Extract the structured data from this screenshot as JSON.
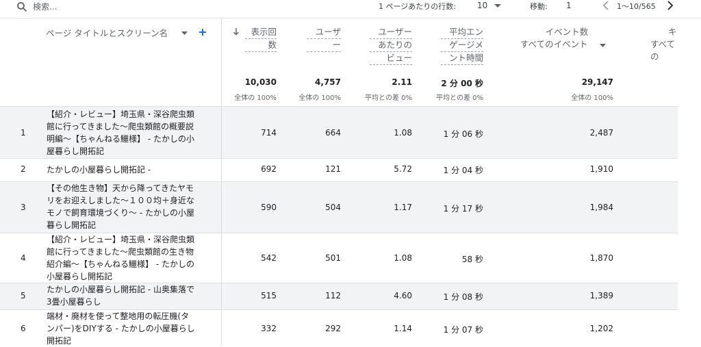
{
  "search": {
    "placeholder": "検索..."
  },
  "pagination": {
    "rows_label": "1 ページあたりの行数:",
    "rows_value": "10",
    "goto_label": "移動:",
    "goto_value": "1",
    "range": "1〜10/565"
  },
  "headers": {
    "dimension": "ページ タイトルとスクリーン名",
    "views": [
      "表示回",
      "数"
    ],
    "users": [
      "ユーザ",
      "ー"
    ],
    "views_per_user": [
      "ユーザー",
      "あたりの",
      "ビュー"
    ],
    "avg_engagement": [
      "平均エン",
      "ゲージメ",
      "ント時間"
    ],
    "event_count": "イベント数",
    "event_filter": "すべてのイベント",
    "next_col": "キ",
    "next_col_sub": "すべての"
  },
  "totals": {
    "views": "10,030",
    "views_sub": "全体の 100%",
    "users": "4,757",
    "users_sub": "全体の 100%",
    "vpu": "2.11",
    "vpu_sub": "平均との差 0%",
    "eng": "2 分 00 秒",
    "eng_sub": "平均との差 0%",
    "events": "29,147",
    "events_sub": "全体の 100%"
  },
  "rows": [
    {
      "n": "1",
      "title": [
        "【紹介・レビュー】埼玉県・深谷爬虫類",
        "館に行ってきました〜爬虫類館の概要説",
        "明編〜【ちゃんねる鱷様】 - たかしの小",
        "屋暮らし開拓記"
      ],
      "views": "714",
      "users": "664",
      "vpu": "1.08",
      "eng": "1 分 06 秒",
      "events": "2,487"
    },
    {
      "n": "2",
      "title": [
        "たかしの小屋暮らし開拓記 -"
      ],
      "views": "692",
      "users": "121",
      "vpu": "5.72",
      "eng": "1 分 04 秒",
      "events": "1,910"
    },
    {
      "n": "3",
      "title": [
        "【その他生き物】天から降ってきたヤモ",
        "リをお迎えしました〜１００均＋身近な",
        "モノで飼育環境づくり〜 - たかしの小屋",
        "暮らし開拓記"
      ],
      "views": "590",
      "users": "504",
      "vpu": "1.17",
      "eng": "1 分 17 秒",
      "events": "1,984"
    },
    {
      "n": "4",
      "title": [
        "【紹介・レビュー】埼玉県・深谷爬虫類",
        "館に行ってきました〜爬虫類館の生き物",
        "紹介編〜【ちゃんねる鱷様】 - たかしの",
        "小屋暮らし開拓記"
      ],
      "views": "542",
      "users": "501",
      "vpu": "1.08",
      "eng": "58 秒",
      "events": "1,870"
    },
    {
      "n": "5",
      "title": [
        "たかしの小屋暮らし開拓記 - 山奥集落で",
        "3畳小屋暮らし"
      ],
      "views": "515",
      "users": "112",
      "vpu": "4.60",
      "eng": "1 分 08 秒",
      "events": "1,389"
    },
    {
      "n": "6",
      "title": [
        "端材・廃材を使って整地用の転圧機(タ",
        "ンパー)をDIYする - たかしの小屋暮らし",
        "開拓記"
      ],
      "views": "332",
      "users": "292",
      "vpu": "1.14",
      "eng": "1 分 07 秒",
      "events": "1,202"
    }
  ]
}
